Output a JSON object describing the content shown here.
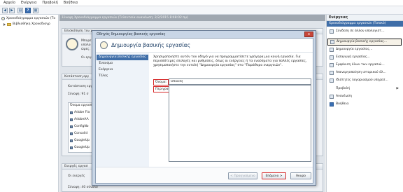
{
  "menubar": {
    "items": [
      "Αρχείο",
      "Ενέργεια",
      "Προβολή",
      "Βοήθεια"
    ]
  },
  "toolbar": {
    "icons": [
      "back-icon",
      "forward-icon",
      "show-hide-tree-icon",
      "help-icon",
      "properties-icon"
    ],
    "help_glyph": "?"
  },
  "tree": {
    "root_label": "Χρονοδιάγραμμα εργασιών (Το",
    "child_label": "Βιβλιοθήκη Χρονοδιαγρ"
  },
  "center": {
    "header_text": "Σύνοψη Χρονοδιάγραμμα εργασιών (Τελευταία ανανέωση: 2/2/2015 8:48:02 πμ)",
    "overview_title": "Επισκόπηση του χ",
    "overview_lines": [
      "Μπορε",
      "υπολο",
      "ώρες."
    ],
    "overview_line2": "Οι εργα",
    "status_title": "Κατάσταση εργ",
    "status_line1": "Κατάσταση εργ",
    "status_summary": "Σύνοψη: 91 σ",
    "tasks_header": "Όνομα εργασί",
    "task_rows": [
      "Adobe Fla",
      "AdobeAA",
      "ConfigNo",
      "Consolid",
      "GoogleUp",
      "GoogleUp"
    ],
    "active_title": "Ενεργές εργασ",
    "active_line": "Οι ενεργές",
    "active_summary": "Σύνοψη: 40 σύνολο"
  },
  "actions": {
    "title": "Ενέργειες",
    "subtitle": "Χρονοδιάγραμμα εργασιών (Τοπικό)",
    "items": [
      {
        "label": "Σύνδεση σε άλλον υπολογιστ...",
        "icon": "connect-icon"
      },
      {
        "label": "Δημιουργία βασικής εργασίας...",
        "icon": "create-basic-task-icon"
      },
      {
        "label": "Δημιουργία εργασίας...",
        "icon": "create-task-icon"
      },
      {
        "label": "Εισαγωγή εργασίας...",
        "icon": "import-task-icon"
      },
      {
        "label": "Εμφάνιση όλων των εργασιώ...",
        "icon": "show-running-tasks-icon"
      },
      {
        "label": "Απενεργοποίηση ιστορικού όλ...",
        "icon": "disable-history-icon"
      },
      {
        "label": "Ιδιότητες λογαριασμού υπηρεσ...",
        "icon": "account-properties-icon"
      },
      {
        "label": "Προβολή",
        "icon": "view-icon",
        "arrow": "▶"
      },
      {
        "label": "Ανανέωση",
        "icon": "refresh-icon"
      },
      {
        "label": "Βοήθεια",
        "icon": "help-icon"
      }
    ]
  },
  "wizard": {
    "window_title": "Οδηγός δημιουργίας βασικής εργασίας",
    "close_glyph": "x",
    "header_title": "Δημιουργία βασικής εργασίας",
    "steps": [
      "Δημιουργία βασικής εργασίας",
      "Έναυσμα",
      "Ενέργεια",
      "Τέλος"
    ],
    "description": "Χρησιμοποιήστε αυτόν τον οδηγό για να προγραμματίσετε γρήγορα μια κοινή εργασία. Για περισσότερες επιλογές και ρυθμίσεις, όπως οι ενέργειες ή τα εναύσματα για πολλές εργασίες, χρησιμοποιήστε την εντολή \"Δημιουργία εργασίας\" στο \"Παράθυρο ενεργειών\".",
    "name_label": "Όνομα:",
    "name_value": "Οπιoc6|",
    "description_label": "Περιγραφή:",
    "description_value": "",
    "buttons": {
      "back": "< Προηγούμενο",
      "next": "Επόμενο >",
      "cancel": "Άκυρο"
    }
  }
}
